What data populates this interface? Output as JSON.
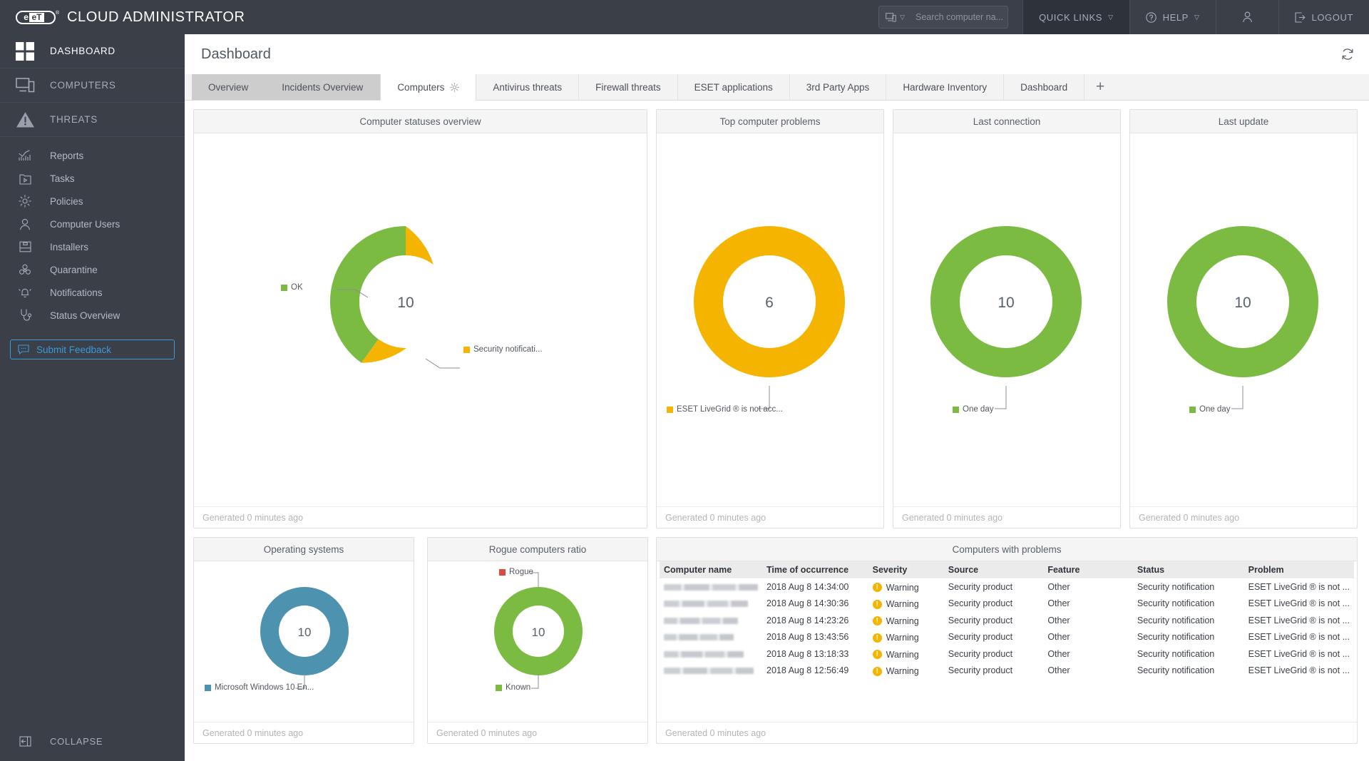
{
  "app": {
    "brand_mark": "eset",
    "brand_title": "CLOUD ADMINISTRATOR"
  },
  "topbar": {
    "search": {
      "placeholder": "Search computer na...",
      "value": "",
      "icon": "computer-icon",
      "caret": "▽"
    },
    "quick_links": {
      "label": "QUICK LINKS",
      "caret": "▽"
    },
    "help": {
      "label": "HELP",
      "caret": "▽",
      "icon": "question-circle-icon"
    },
    "user": {
      "label": "",
      "icon": "person-icon"
    },
    "logout": {
      "label": "LOGOUT",
      "icon": "logout-icon"
    }
  },
  "sidebar": {
    "major": [
      {
        "label": "DASHBOARD",
        "icon": "grid-icon",
        "selected": true
      },
      {
        "label": "COMPUTERS",
        "icon": "computer-icon",
        "selected": false
      },
      {
        "label": "THREATS",
        "icon": "warning-triangle-icon",
        "selected": false
      }
    ],
    "minor": [
      {
        "label": "Reports",
        "icon": "chart-icon"
      },
      {
        "label": "Tasks",
        "icon": "task-play-icon"
      },
      {
        "label": "Policies",
        "icon": "gear-icon"
      },
      {
        "label": "Computer Users",
        "icon": "person-icon"
      },
      {
        "label": "Installers",
        "icon": "installer-box-icon"
      },
      {
        "label": "Quarantine",
        "icon": "biohazard-icon"
      },
      {
        "label": "Notifications",
        "icon": "bell-icon"
      },
      {
        "label": "Status Overview",
        "icon": "stethoscope-icon"
      }
    ],
    "feedback": {
      "label": "Submit Feedback",
      "icon": "speech-bubble-icon",
      "color": "#3a9ad9"
    },
    "collapse": {
      "label": "COLLAPSE",
      "icon": "collapse-panel-icon"
    }
  },
  "page": {
    "title": "Dashboard",
    "refresh_icon": "refresh-icon"
  },
  "tabs": {
    "items": [
      {
        "label": "Overview",
        "state": "gray"
      },
      {
        "label": "Incidents Overview",
        "state": "gray"
      },
      {
        "label": "Computers",
        "state": "active",
        "gear": true
      },
      {
        "label": "Antivirus threats",
        "state": "normal"
      },
      {
        "label": "Firewall threats",
        "state": "normal"
      },
      {
        "label": "ESET applications",
        "state": "normal"
      },
      {
        "label": "3rd Party Apps",
        "state": "normal"
      },
      {
        "label": "Hardware Inventory",
        "state": "normal"
      },
      {
        "label": "Dashboard",
        "state": "normal"
      }
    ],
    "add_label": "+"
  },
  "colors": {
    "green": "#7cbb42",
    "yellow": "#f5b400",
    "blue": "#4d92ae",
    "red": "#d94b3f",
    "dark": "#3a3f48"
  },
  "footer_text": "Generated 0 minutes ago",
  "chart_data": [
    {
      "type": "pie",
      "title": "Computer statuses overview",
      "center_value": "10",
      "categories": [
        "OK",
        "Security notificati..."
      ],
      "values": [
        4,
        6
      ],
      "colors": [
        "#7cbb42",
        "#f5b400"
      ],
      "legend": "callout",
      "footer": "Generated 0 minutes ago"
    },
    {
      "type": "pie",
      "title": "Top computer problems",
      "center_value": "6",
      "categories": [
        "ESET LiveGrid ® is not acc..."
      ],
      "values": [
        6
      ],
      "colors": [
        "#f5b400"
      ],
      "legend": "callout",
      "footer": "Generated 0 minutes ago"
    },
    {
      "type": "pie",
      "title": "Last connection",
      "center_value": "10",
      "categories": [
        "One day"
      ],
      "values": [
        10
      ],
      "colors": [
        "#7cbb42"
      ],
      "legend": "callout",
      "footer": "Generated 0 minutes ago"
    },
    {
      "type": "pie",
      "title": "Last update",
      "center_value": "10",
      "categories": [
        "One day"
      ],
      "values": [
        10
      ],
      "colors": [
        "#7cbb42"
      ],
      "legend": "callout",
      "footer": "Generated 0 minutes ago"
    },
    {
      "type": "pie",
      "title": "Operating systems",
      "center_value": "10",
      "categories": [
        "Microsoft Windows 10 En..."
      ],
      "values": [
        10
      ],
      "colors": [
        "#4d92ae"
      ],
      "legend": "callout",
      "footer": "Generated 0 minutes ago"
    },
    {
      "type": "pie",
      "title": "Rogue computers ratio",
      "center_value": "10",
      "categories": [
        "Rogue",
        "Known"
      ],
      "values": [
        0,
        10
      ],
      "colors": [
        "#d94b3f",
        "#7cbb42"
      ],
      "legend": "callout",
      "footer": "Generated 0 minutes ago"
    }
  ],
  "problems_table": {
    "title": "Computers with problems",
    "footer": "Generated 0 minutes ago",
    "columns": [
      "Computer name",
      "Time of occurrence",
      "Severity",
      "Source",
      "Feature",
      "Status",
      "Problem"
    ],
    "rows": [
      {
        "computer_name": "",
        "redacted": true,
        "time": "2018 Aug 8 14:34:00",
        "severity": "Warning",
        "source": "Security product",
        "feature": "Other",
        "status": "Security notification",
        "problem": "ESET LiveGrid ® is not ..."
      },
      {
        "computer_name": "",
        "redacted": true,
        "time": "2018 Aug 8 14:30:36",
        "severity": "Warning",
        "source": "Security product",
        "feature": "Other",
        "status": "Security notification",
        "problem": "ESET LiveGrid ® is not ..."
      },
      {
        "computer_name": "",
        "redacted": true,
        "time": "2018 Aug 8 14:23:26",
        "severity": "Warning",
        "source": "Security product",
        "feature": "Other",
        "status": "Security notification",
        "problem": "ESET LiveGrid ® is not ..."
      },
      {
        "computer_name": "",
        "redacted": true,
        "time": "2018 Aug 8 13:43:56",
        "severity": "Warning",
        "source": "Security product",
        "feature": "Other",
        "status": "Security notification",
        "problem": "ESET LiveGrid ® is not ..."
      },
      {
        "computer_name": "",
        "redacted": true,
        "time": "2018 Aug 8 13:18:33",
        "severity": "Warning",
        "source": "Security product",
        "feature": "Other",
        "status": "Security notification",
        "problem": "ESET LiveGrid ® is not ..."
      },
      {
        "computer_name": "",
        "redacted": true,
        "time": "2018 Aug 8 12:56:49",
        "severity": "Warning",
        "source": "Security product",
        "feature": "Other",
        "status": "Security notification",
        "problem": "ESET LiveGrid ® is not ..."
      }
    ]
  }
}
